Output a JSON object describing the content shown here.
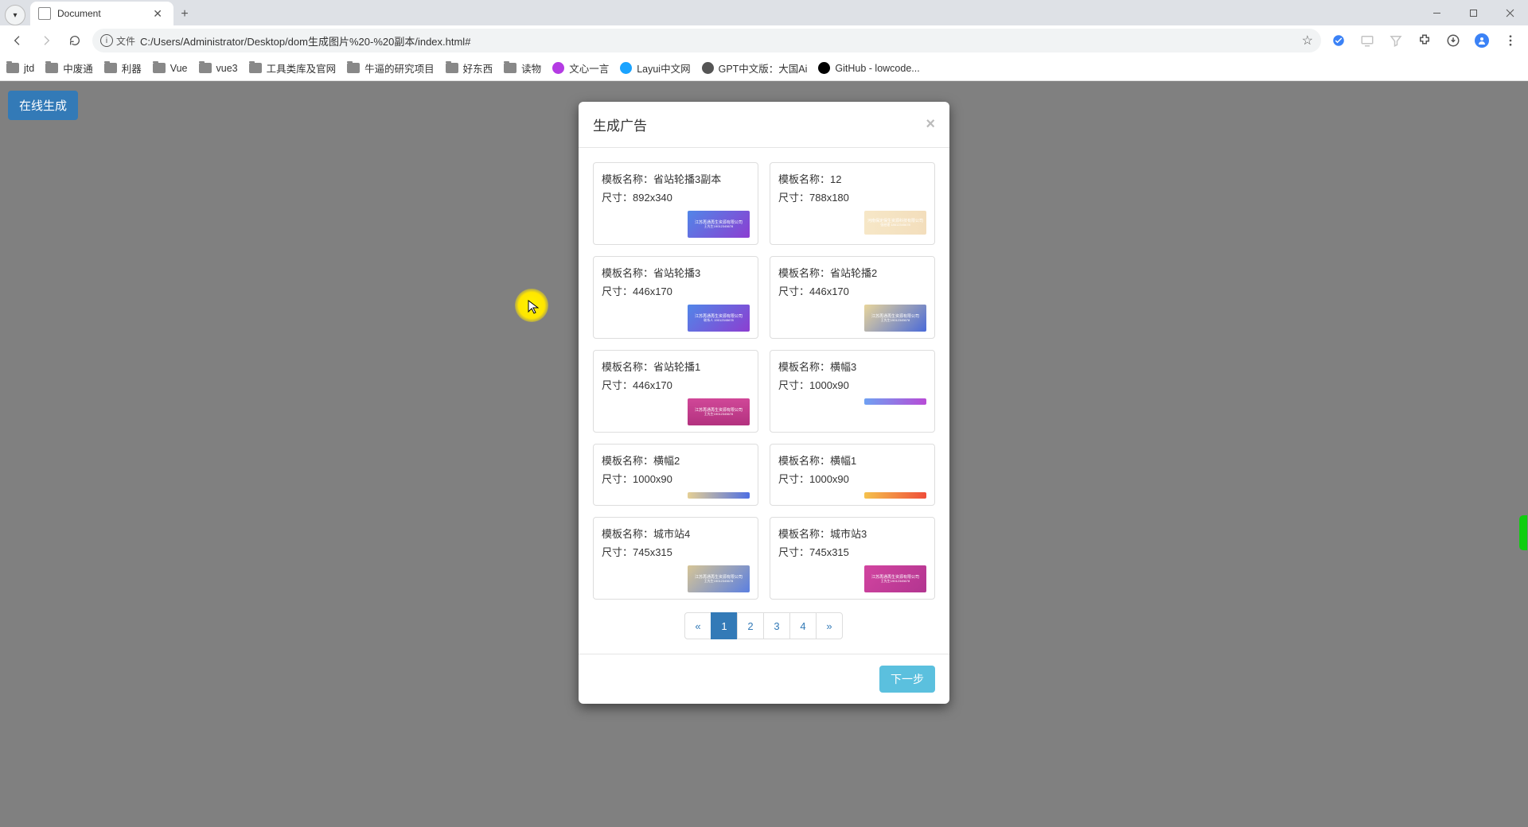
{
  "browser": {
    "tab_title": "Document",
    "new_tab_plus": "+",
    "address": {
      "scheme_label": "文件",
      "url": "C:/Users/Administrator/Desktop/dom生成图片%20-%20副本/index.html#"
    },
    "bookmarks": [
      {
        "type": "folder",
        "label": "jtd"
      },
      {
        "type": "folder",
        "label": "中废通"
      },
      {
        "type": "folder",
        "label": "利器"
      },
      {
        "type": "folder",
        "label": "Vue"
      },
      {
        "type": "folder",
        "label": "vue3"
      },
      {
        "type": "folder",
        "label": "工具类库及官网"
      },
      {
        "type": "folder",
        "label": "牛逼的研究项目"
      },
      {
        "type": "folder",
        "label": "好东西"
      },
      {
        "type": "folder",
        "label": "读物"
      },
      {
        "type": "site",
        "icon_bg": "#b43be3",
        "label": "文心一言"
      },
      {
        "type": "site",
        "icon_bg": "#1aa3ff",
        "label": "Layui中文网"
      },
      {
        "type": "site",
        "icon_bg": "#555",
        "label": "GPT中文版：大国Ai"
      },
      {
        "type": "site",
        "icon_bg": "#000",
        "label": "GitHub - lowcode..."
      }
    ]
  },
  "page": {
    "generate_button": "在线生成"
  },
  "modal": {
    "title": "生成广告",
    "name_prefix": "模板名称：",
    "size_prefix": "尺寸：",
    "footer_button": "下一步"
  },
  "templates": [
    {
      "name": "省站轮播3副本",
      "size": "892x340",
      "thumb_text": "江苏再通再生资源有限公司",
      "thumb_sub": "王先生19012345678",
      "thumb_style": "linear-gradient(135deg,#5186e8,#8c3ed1)",
      "h": "tall"
    },
    {
      "name": "12",
      "size": "788x180",
      "thumb_text": "河南保定保生资源科技有限公司",
      "thumb_sub": "张经理 18612345678",
      "thumb_style": "linear-gradient(90deg,#f6e7c7,#f3debc)",
      "h": ""
    },
    {
      "name": "省站轮播3",
      "size": "446x170",
      "thumb_text": "江苏再通再生资源有限公司",
      "thumb_sub": "联系人 19012345678",
      "thumb_style": "linear-gradient(135deg,#5186e8,#8c3ed1)",
      "h": "tall"
    },
    {
      "name": "省站轮播2",
      "size": "446x170",
      "thumb_text": "江苏再通再生资源有限公司",
      "thumb_sub": "王先生19012345678",
      "thumb_style": "linear-gradient(135deg,#e8d59b,#4a6ad8)",
      "h": "tall"
    },
    {
      "name": "省站轮播1",
      "size": "446x170",
      "thumb_text": "江苏再通再生资源有限公司",
      "thumb_sub": "王先生19012345678",
      "thumb_style": "linear-gradient(180deg,#d04798,#b3327f)",
      "h": "tall"
    },
    {
      "name": "横幅3",
      "size": "1000x90",
      "thumb_text": "",
      "thumb_sub": "",
      "thumb_style": "linear-gradient(90deg,#6fa1f2,#b84bd6)",
      "h": "thin"
    },
    {
      "name": "横幅2",
      "size": "1000x90",
      "thumb_text": "",
      "thumb_sub": "",
      "thumb_style": "linear-gradient(90deg,#e5cf95,#4f6fe2)",
      "h": "thin"
    },
    {
      "name": "横幅1",
      "size": "1000x90",
      "thumb_text": "",
      "thumb_sub": "",
      "thumb_style": "linear-gradient(90deg,#f5c24d,#ef4e3a)",
      "h": "thin"
    },
    {
      "name": "城市站4",
      "size": "745x315",
      "thumb_text": "江苏再通再生资源有限公司",
      "thumb_sub": "王先生19012345678",
      "thumb_style": "linear-gradient(135deg,#d6c596,#5b7fe0)",
      "h": "tall"
    },
    {
      "name": "城市站3",
      "size": "745x315",
      "thumb_text": "江苏再通再生资源有限公司",
      "thumb_sub": "王先生19012345678",
      "thumb_style": "linear-gradient(135deg,#d244a0,#b23590)",
      "h": "tall"
    }
  ],
  "pagination": {
    "prev": "«",
    "pages": [
      "1",
      "2",
      "3",
      "4"
    ],
    "active": "1",
    "next": "»"
  }
}
